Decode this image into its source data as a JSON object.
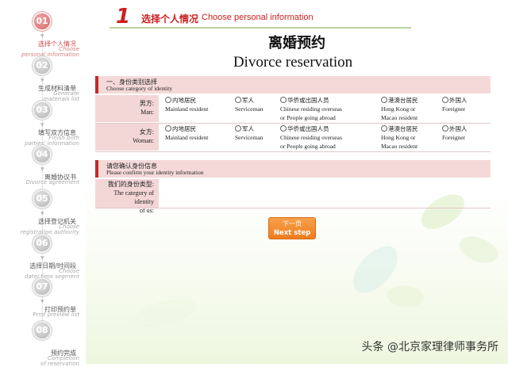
{
  "steps": [
    {
      "num": "01",
      "zh": "选择个人情况",
      "en": "Choose\npersonal information",
      "active": true
    },
    {
      "num": "02",
      "zh": "生成材料清单",
      "en": "Generate\nmaterials list",
      "active": false
    },
    {
      "num": "03",
      "zh": "填写双方信息",
      "en": "Finish both\nparties' information",
      "active": false
    },
    {
      "num": "04",
      "zh": "离婚协议书",
      "en": "Divorce agreement",
      "active": false
    },
    {
      "num": "05",
      "zh": "选择登记机关",
      "en": "Choose\nregistration authority",
      "active": false
    },
    {
      "num": "06",
      "zh": "选择日期/时间段",
      "en": "Choose\ndate/ time segment",
      "active": false
    },
    {
      "num": "07",
      "zh": "打印预约单",
      "en": "Print preview list",
      "active": false
    },
    {
      "num": "08",
      "zh": "预约完成",
      "en": "Completion\nof reservation",
      "active": false
    }
  ],
  "header": {
    "step_number": "1",
    "title_zh": "选择个人情况",
    "title_en": "Choose personal information"
  },
  "page_title": {
    "zh": "离婚预约",
    "en": "Divorce reservation"
  },
  "identity_section": {
    "title_zh": "一、身份类别选择",
    "title_en": "Choose category of identity",
    "man_label_zh": "男方:",
    "man_label_en": "Man:",
    "woman_label_zh": "女方:",
    "woman_label_en": "Woman:",
    "options": [
      {
        "zh": "内地居民",
        "en": "Mainland resident",
        "en2": ""
      },
      {
        "zh": "军人",
        "en": "Serviceman",
        "en2": ""
      },
      {
        "zh": "华侨或出国人员",
        "en": "Chinese residing overseas",
        "en2": "or People going abroad"
      },
      {
        "zh": "港澳台居民",
        "en": "Hong Kong or",
        "en2": "Macao resident"
      },
      {
        "zh": "外国人",
        "en": "Foreigner",
        "en2": ""
      }
    ]
  },
  "confirm_section": {
    "title_zh": "请您确认身份信息",
    "title_en": "Please confirm your identity information",
    "label_zh": "我们的身份类型:",
    "label_en1": "The category of identity",
    "label_en2": "of us:"
  },
  "next_button": {
    "zh": "下一页",
    "en": "Next step"
  },
  "watermark": "头条 @北京家理律师事务所",
  "colors": {
    "accent_red": "#cc1f1f",
    "section_bg": "#f5d9d9",
    "button_orange": "#ee7d1f"
  }
}
